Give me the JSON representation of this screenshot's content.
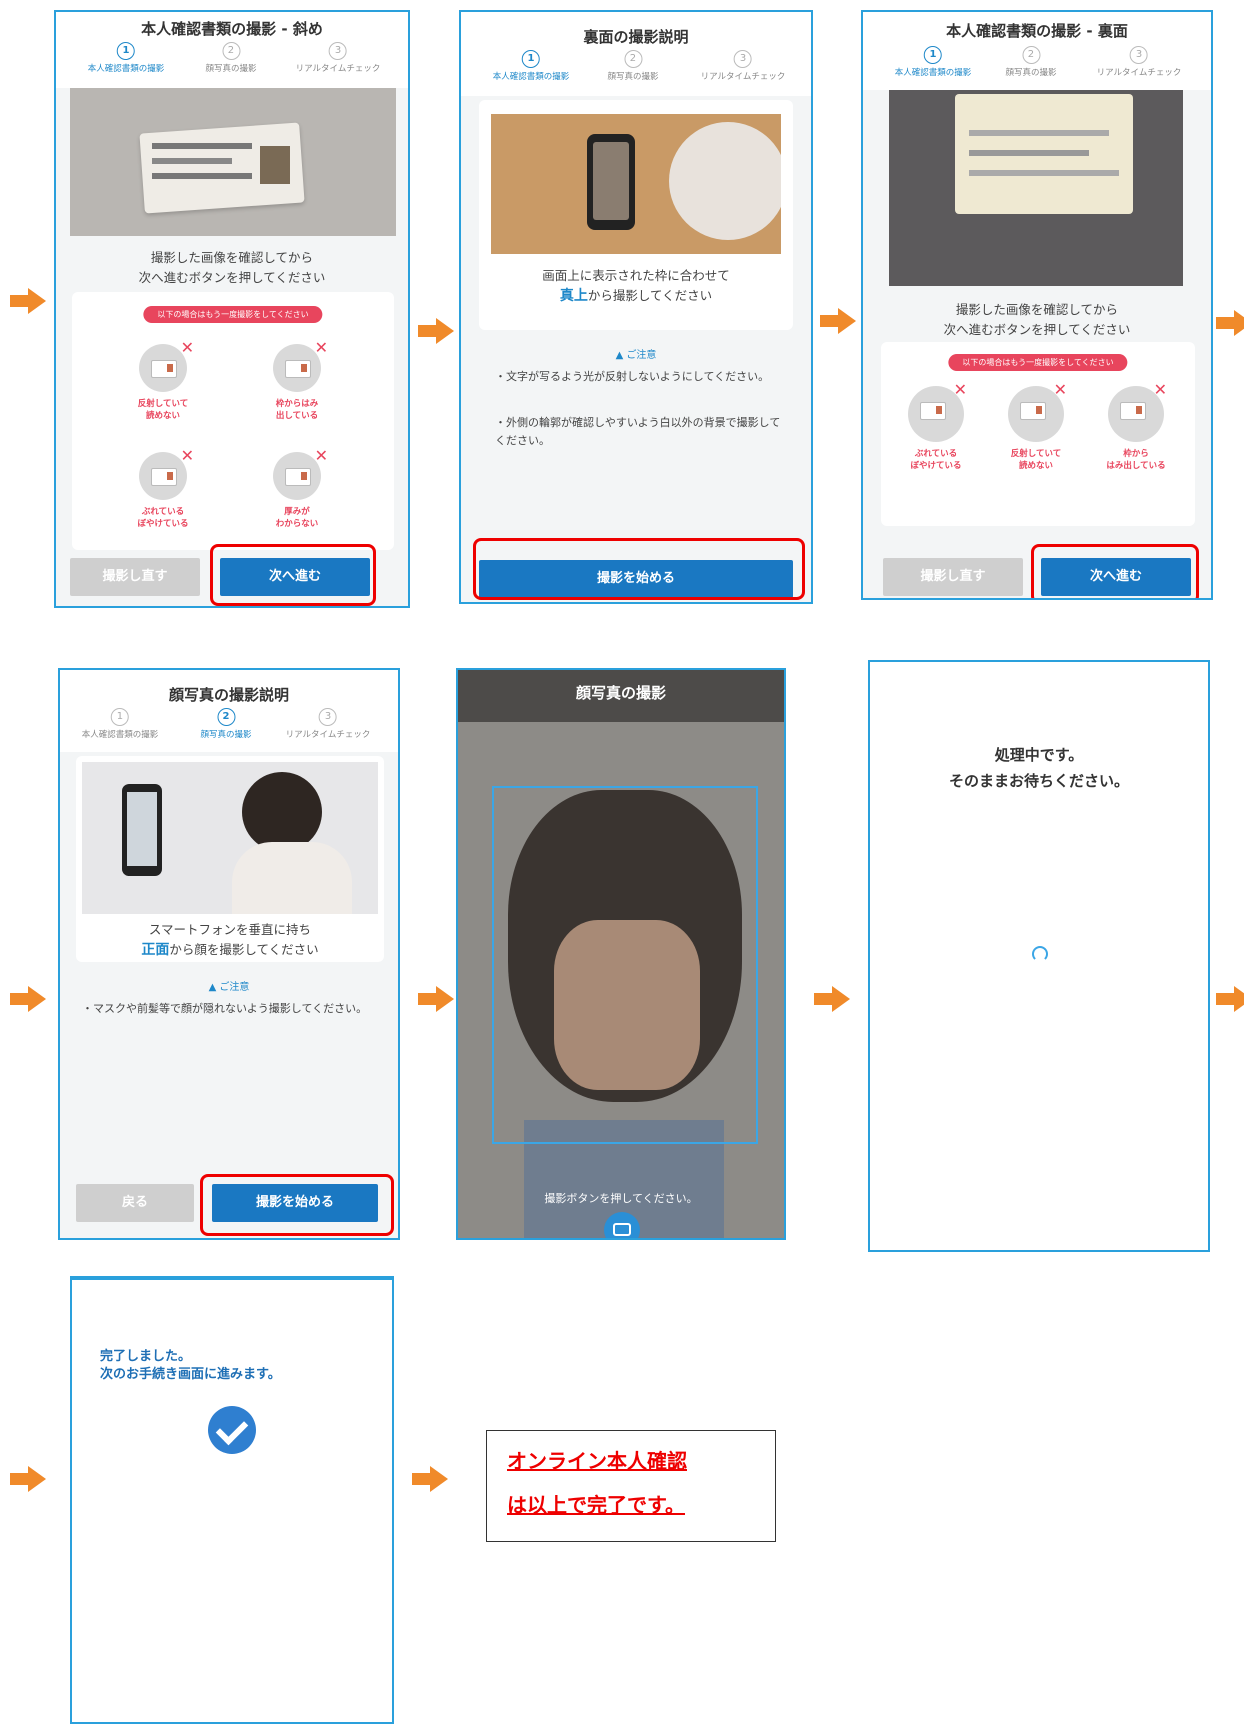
{
  "steps": [
    "本人確認書類の撮影",
    "顔写真の撮影",
    "リアルタイムチェック"
  ],
  "screen1": {
    "title": "本人確認書類の撮影 - 斜め",
    "message_l1": "撮影した画像を確認してから",
    "message_l2": "次へ進むボタンを押してください",
    "retake_pill": "以下の場合はもう一度撮影をしてください",
    "samples": [
      "反射していて\n読めない",
      "枠からはみ\n出している",
      "ぶれている\nぼやけている",
      "厚みが\nわからない"
    ],
    "retake_button": "撮影し直す",
    "next_button": "次へ進む"
  },
  "screen2": {
    "title": "裏面の撮影説明",
    "message_l1": "画面上に表示された枠に合わせて",
    "message_emph": "真上",
    "message_l2": "から撮影してください",
    "caution": "▲ ご注意",
    "note1": "・文字が写るよう光が反射しないようにしてください。",
    "note2": "・外側の輪郭が確認しやすいよう白以外の背景で撮影してください。",
    "start_button": "撮影を始める"
  },
  "screen3": {
    "title": "本人確認書類の撮影 - 裏面",
    "message_l1": "撮影した画像を確認してから",
    "message_l2": "次へ進むボタンを押してください",
    "retake_pill": "以下の場合はもう一度撮影をしてください",
    "samples": [
      "ぶれている\nぼやけている",
      "反射していて\n読めない",
      "枠から\nはみ出している"
    ],
    "retake_button": "撮影し直す",
    "next_button": "次へ進む"
  },
  "screen4": {
    "title": "顔写真の撮影説明",
    "message_l1": "スマートフォンを垂直に持ち",
    "message_emph": "正面",
    "message_l2": "から顔を撮影してください",
    "caution": "▲ ご注意",
    "note1": "・マスクや前髪等で顔が隠れないよう撮影してください。",
    "back_button": "戻る",
    "start_button": "撮影を始める"
  },
  "screen5": {
    "title": "顔写真の撮影",
    "hint": "撮影ボタンを押してください。",
    "camera_icon": "camera-icon"
  },
  "screen6": {
    "line1": "処理中です。",
    "line2": "そのままお待ちください。"
  },
  "screen7": {
    "line1": "完了しました。",
    "line2": "次のお手続き画面に進みます。"
  },
  "final_note": {
    "line1": "オンライン本人確認",
    "line2": "は以上で完了です。"
  },
  "colors": {
    "arrow": "#f08a2a",
    "frame": "#2aa0dc",
    "primary": "#1a78c2",
    "alert": "#e8455d",
    "highlight": "#e00000"
  }
}
